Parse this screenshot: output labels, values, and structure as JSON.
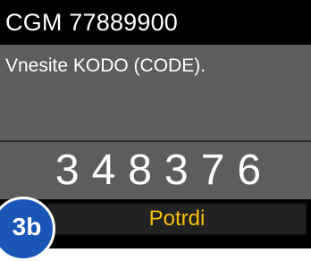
{
  "header": {
    "title": "CGM 77889900"
  },
  "message": {
    "text": "Vnesite KODO (CODE)."
  },
  "code": {
    "value": "348376"
  },
  "actions": {
    "confirm_label": "Potrdi"
  },
  "badge": {
    "label": "3b"
  },
  "colors": {
    "screen_background": "#5d5d5d",
    "bar_background": "#000000",
    "confirm_text": "#f4c20d",
    "badge_background": "#1a56b8"
  }
}
